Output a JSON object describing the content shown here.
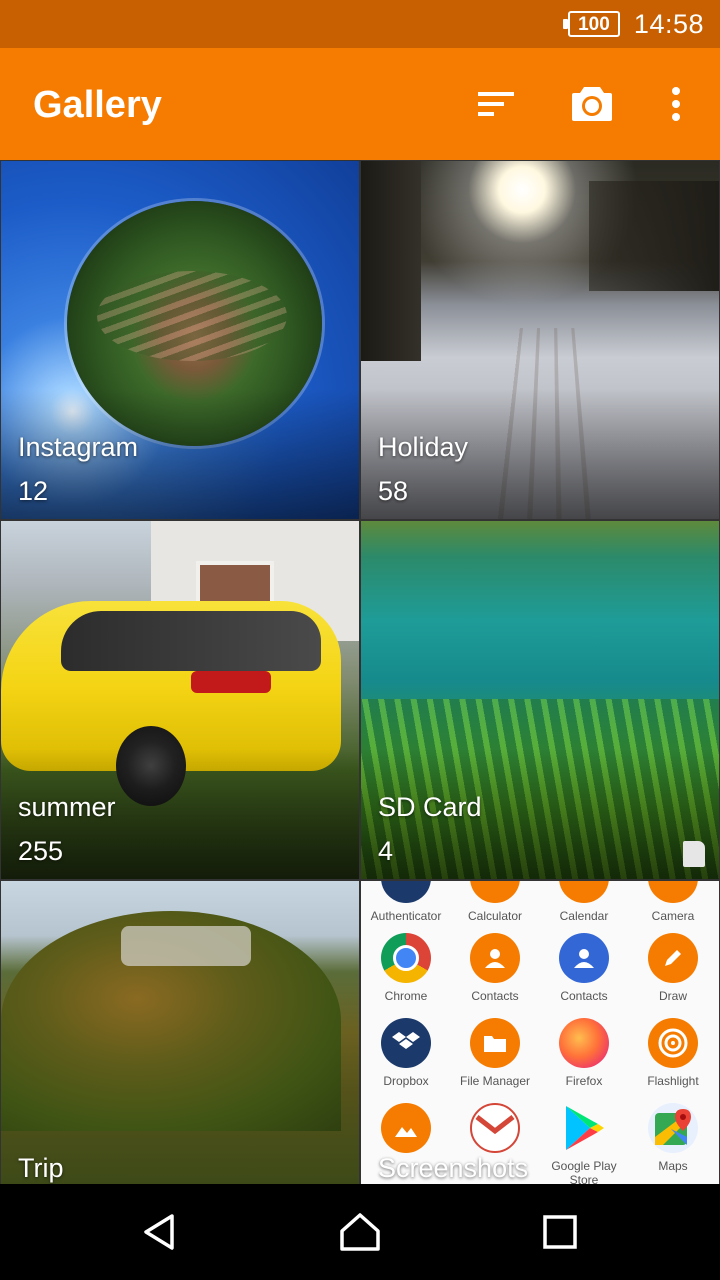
{
  "status_bar": {
    "battery": "100",
    "time": "14:58"
  },
  "app_bar": {
    "title": "Gallery",
    "actions": [
      "sort-icon",
      "camera-icon",
      "more-vert-icon"
    ]
  },
  "albums": [
    {
      "name": "Instagram",
      "count": "12"
    },
    {
      "name": "Holiday",
      "count": "58"
    },
    {
      "name": "summer",
      "count": "255"
    },
    {
      "name": "SD Card",
      "count": "4"
    },
    {
      "name": "Trip",
      "count": ""
    },
    {
      "name": "Screenshots",
      "count": ""
    }
  ],
  "screenshot_apps": [
    {
      "label": "Authenticator"
    },
    {
      "label": "Calculator"
    },
    {
      "label": "Calendar"
    },
    {
      "label": "Camera"
    },
    {
      "label": "Chrome"
    },
    {
      "label": "Contacts"
    },
    {
      "label": "Contacts"
    },
    {
      "label": "Draw"
    },
    {
      "label": "Dropbox"
    },
    {
      "label": "File Manager"
    },
    {
      "label": "Firefox"
    },
    {
      "label": "Flashlight"
    },
    {
      "label": ""
    },
    {
      "label": ""
    },
    {
      "label": "Google Play Store"
    },
    {
      "label": "Maps"
    }
  ],
  "colors": {
    "status_bar": "#c85f00",
    "app_bar": "#f57c00",
    "nav_bar": "#000000"
  },
  "nav_bar": {
    "buttons": [
      "back-icon",
      "home-icon",
      "recents-icon"
    ]
  }
}
